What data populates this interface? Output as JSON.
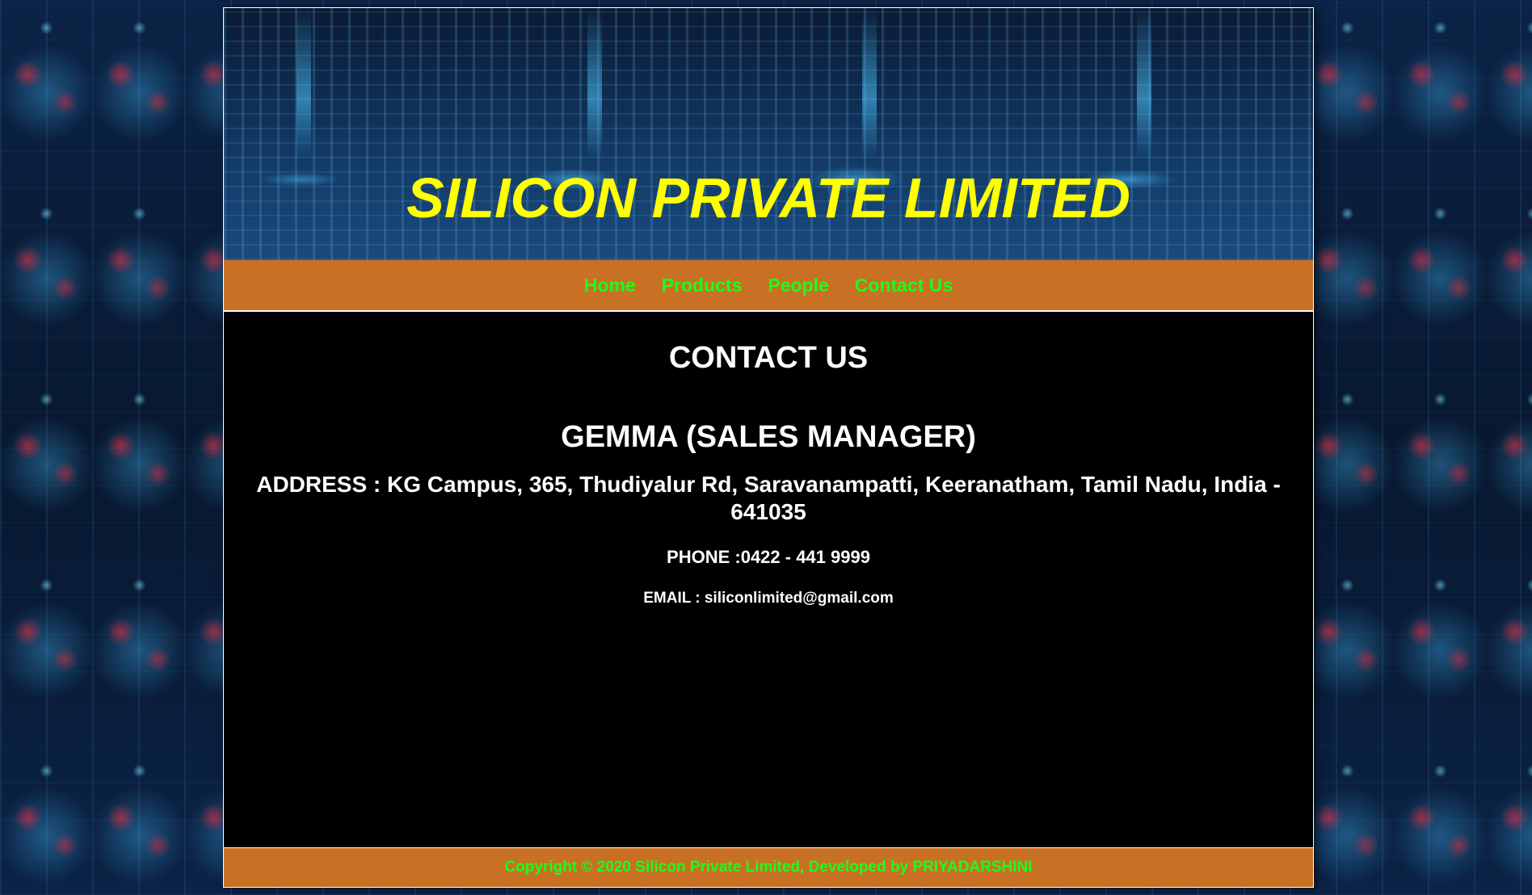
{
  "header": {
    "title": "SILICON PRIVATE LIMITED"
  },
  "nav": {
    "items": [
      {
        "label": "Home"
      },
      {
        "label": "Products"
      },
      {
        "label": "People"
      },
      {
        "label": "Contact Us"
      }
    ]
  },
  "main": {
    "heading": "CONTACT US",
    "contact_name": "GEMMA (SALES MANAGER)",
    "address": "ADDRESS : KG Campus, 365, Thudiyalur Rd, Saravanampatti, Keeranatham, Tamil Nadu, India - 641035",
    "phone": "PHONE :0422 - 441 9999",
    "email": "EMAIL : siliconlimited@gmail.com"
  },
  "footer": {
    "copyright": "Copyright © 2020 Silicon Private Limited, Developed by PRIYADARSHINI"
  },
  "colors": {
    "title": "#ffff00",
    "nav_background": "#c87125",
    "nav_link": "#1aff1a",
    "main_background": "#000000",
    "main_text": "#ffffff"
  }
}
